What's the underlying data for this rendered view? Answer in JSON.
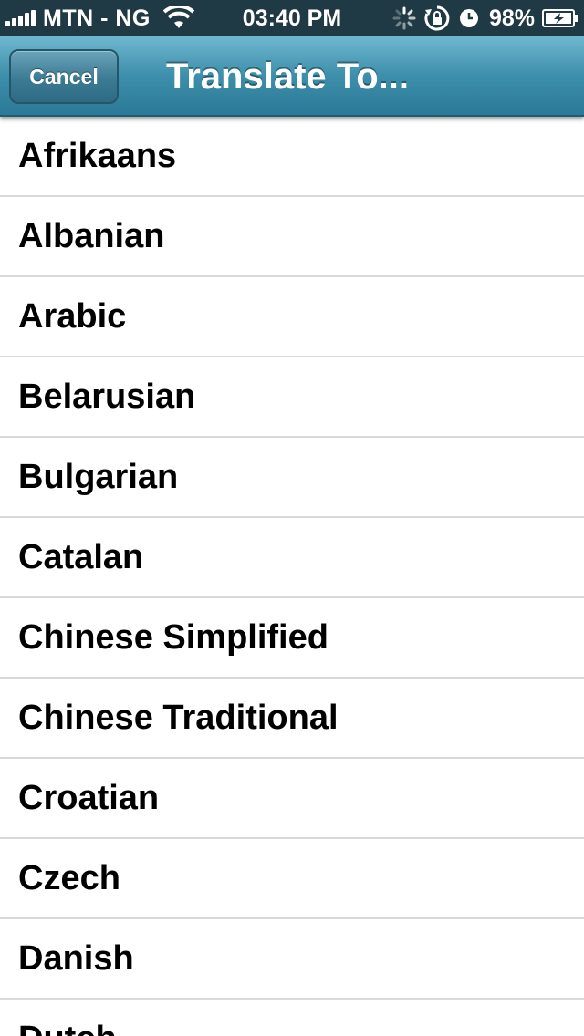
{
  "status_bar": {
    "carrier": "MTN - NG",
    "time": "03:40 PM",
    "battery_percent": "98%",
    "icons": [
      "signal-icon",
      "wifi-icon",
      "activity-spinner-icon",
      "rotation-lock-icon",
      "alarm-icon",
      "battery-charging-icon"
    ]
  },
  "nav": {
    "cancel_label": "Cancel",
    "title": "Translate To..."
  },
  "languages": [
    "Afrikaans",
    "Albanian",
    "Arabic",
    "Belarusian",
    "Bulgarian",
    "Catalan",
    "Chinese Simplified",
    "Chinese Traditional",
    "Croatian",
    "Czech",
    "Danish",
    "Dutch"
  ],
  "colors": {
    "status_bar_bg": "#1f3a44",
    "nav_accent": "#3d8fab",
    "separator": "#d9d9d9"
  }
}
